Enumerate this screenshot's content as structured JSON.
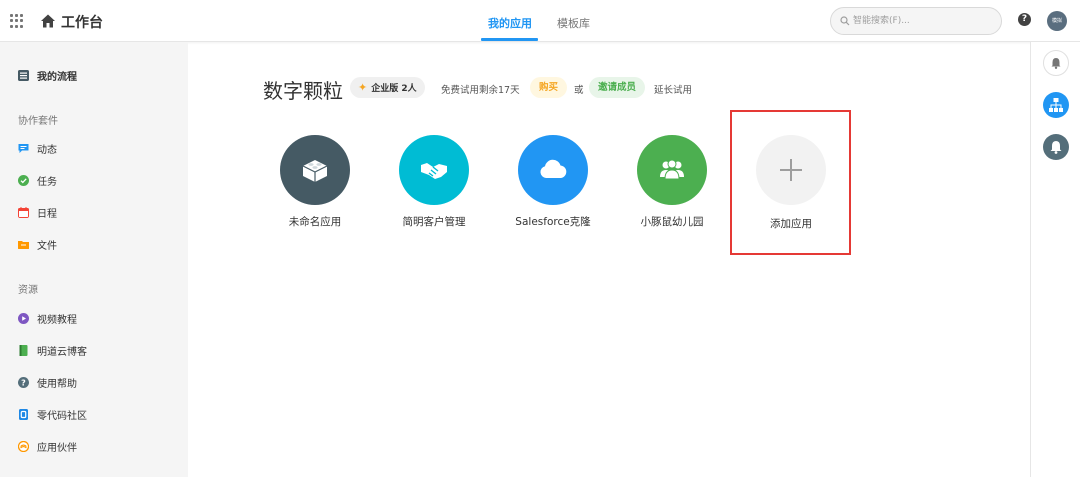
{
  "topbar": {
    "title": "工作台",
    "tabs": [
      {
        "label": "我的应用",
        "active": true
      },
      {
        "label": "模板库",
        "active": false
      }
    ],
    "search_placeholder": "智能搜索(F)...",
    "help_glyph": "?",
    "avatar_text": "模拟",
    "accent_color": "#2196f3"
  },
  "sidebar": {
    "my_flow": "我的流程",
    "section_collab": "协作套件",
    "collab_items": [
      {
        "label": "动态",
        "icon": "chat-icon",
        "color": "#2196f3"
      },
      {
        "label": "任务",
        "icon": "check-icon",
        "color": "#4caf50"
      },
      {
        "label": "日程",
        "icon": "calendar-icon",
        "color": "#f44336"
      },
      {
        "label": "文件",
        "icon": "folder-icon",
        "color": "#ff9800"
      }
    ],
    "section_resources": "资源",
    "resource_items": [
      {
        "label": "视频教程",
        "icon": "play-icon",
        "color": "#7e57c2"
      },
      {
        "label": "明道云博客",
        "icon": "book-icon",
        "color": "#4caf50"
      },
      {
        "label": "使用帮助",
        "icon": "help-icon",
        "color": "#546e7a"
      },
      {
        "label": "零代码社区",
        "icon": "community-icon",
        "color": "#1e88e5"
      },
      {
        "label": "应用伙伴",
        "icon": "partner-icon",
        "color": "#ff9800"
      }
    ]
  },
  "main": {
    "group_title": "数字颗粒",
    "edition_badge": "企业版 2人",
    "trial_text": "免费试用剩余17天",
    "buy_label": "购买",
    "or_text": "或",
    "invite_label": "邀请成员",
    "extend_text": "延长试用",
    "apps": [
      {
        "label": "未命名应用",
        "icon": "lego-icon",
        "color": "#455a64"
      },
      {
        "label": "简明客户管理",
        "icon": "handshake-icon",
        "color": "#00bcd4"
      },
      {
        "label": "Salesforce克隆",
        "icon": "cloud-icon",
        "color": "#2196f3"
      },
      {
        "label": "小豚鼠幼儿园",
        "icon": "people-icon",
        "color": "#4caf50"
      }
    ],
    "add_app_label": "添加应用"
  },
  "rightrail": {
    "items": [
      {
        "icon": "bell-small-icon",
        "color": "#ffffff"
      },
      {
        "icon": "org-chart-icon",
        "color": "#2196f3"
      },
      {
        "icon": "bell-icon",
        "color": "#546e7a"
      }
    ]
  }
}
